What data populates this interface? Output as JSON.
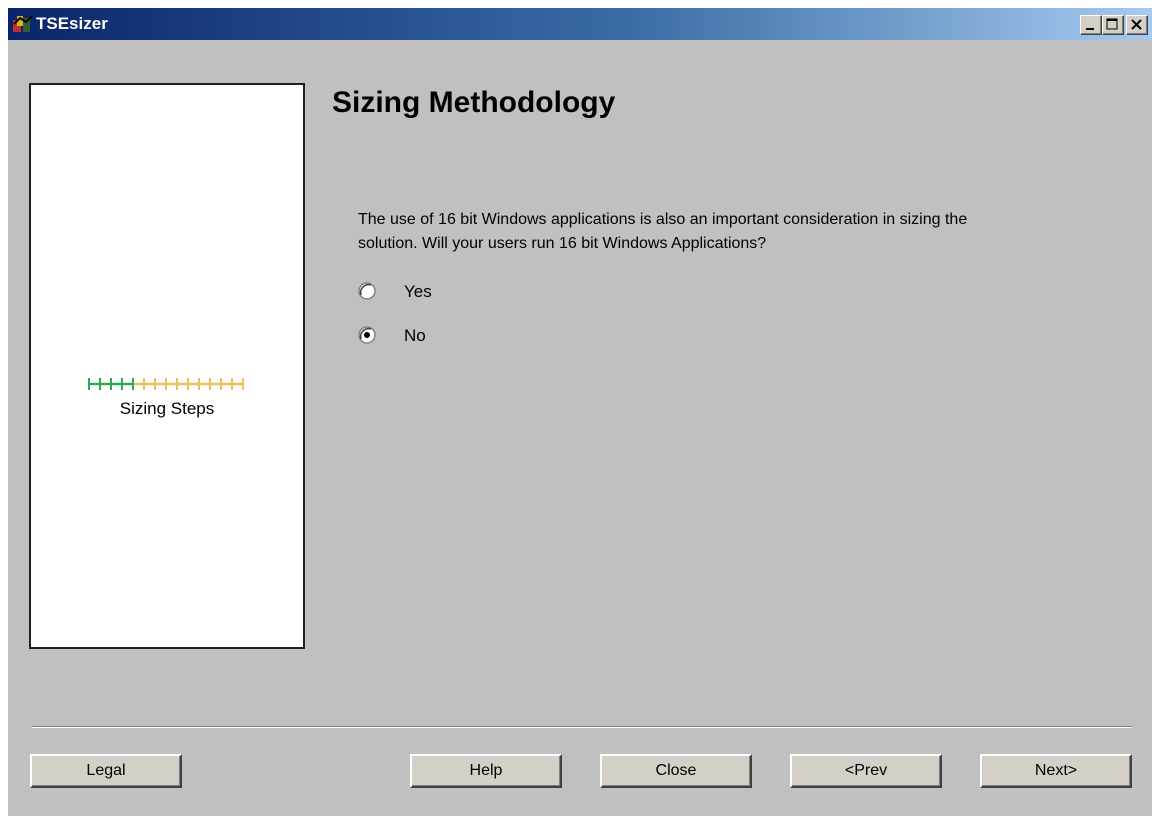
{
  "window": {
    "title": "TSEsizer",
    "icon": "app-icon",
    "controls": [
      "minimize-icon",
      "maximize-icon",
      "close-icon"
    ]
  },
  "sidebar": {
    "steps_label": "Sizing Steps",
    "steps_completed": 4,
    "steps_total": 14,
    "completed_color": "#2fa84f",
    "pending_color": "#f0c060"
  },
  "main": {
    "heading": "Sizing Methodology",
    "question_line1": "The use of 16 bit Windows applications is also an important consideration in sizing the",
    "question_line2": "solution.  Will your users run 16 bit Windows Applications?",
    "options": [
      {
        "label": "Yes",
        "selected": false
      },
      {
        "label": "No",
        "selected": true
      }
    ]
  },
  "footer": {
    "legal": "Legal",
    "help": "Help",
    "close": "Close",
    "prev": "<Prev",
    "next": "Next>"
  }
}
